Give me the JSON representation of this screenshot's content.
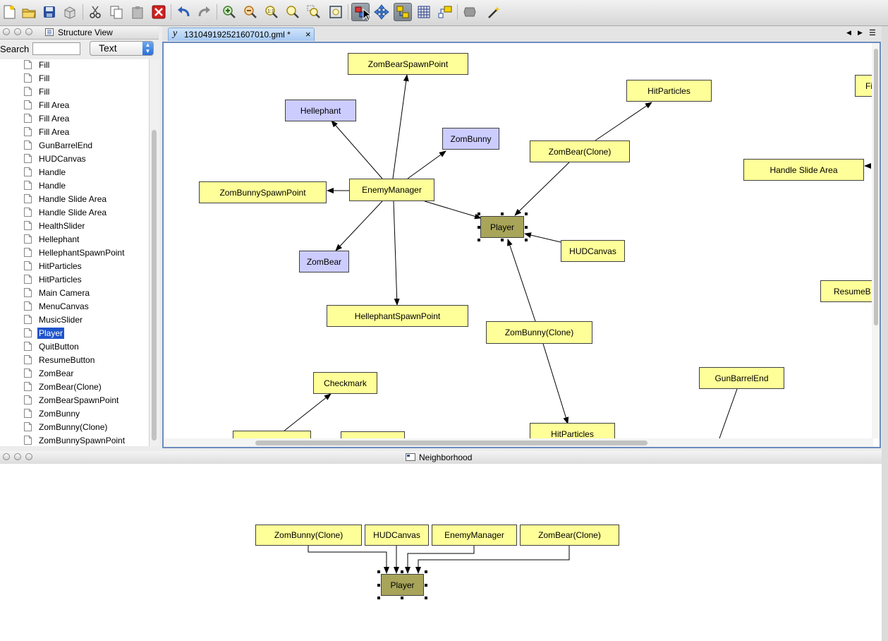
{
  "toolbar": {
    "icons": [
      "new-document",
      "open-folder",
      "save",
      "print",
      "cut",
      "copy",
      "paste",
      "delete",
      "undo",
      "redo",
      "zoom-in",
      "zoom-out",
      "zoom-actual",
      "zoom-fit",
      "zoom-area",
      "fit-content",
      "edit-mode",
      "navigate-mode",
      "snap-mode",
      "grid",
      "properties",
      "group",
      "magic-wand"
    ],
    "active": [
      "edit-mode",
      "snap-mode"
    ]
  },
  "structure": {
    "title": "Structure View",
    "search_label": "Search",
    "search_value": "",
    "filter_selected": "Text",
    "items": [
      {
        "label": "Fill"
      },
      {
        "label": "Fill"
      },
      {
        "label": "Fill"
      },
      {
        "label": "Fill Area"
      },
      {
        "label": "Fill Area"
      },
      {
        "label": "Fill Area"
      },
      {
        "label": "GunBarrelEnd"
      },
      {
        "label": "HUDCanvas"
      },
      {
        "label": "Handle"
      },
      {
        "label": "Handle"
      },
      {
        "label": "Handle Slide Area"
      },
      {
        "label": "Handle Slide Area"
      },
      {
        "label": "HealthSlider"
      },
      {
        "label": "Hellephant"
      },
      {
        "label": "HellephantSpawnPoint"
      },
      {
        "label": "HitParticles"
      },
      {
        "label": "HitParticles"
      },
      {
        "label": "Main Camera"
      },
      {
        "label": "MenuCanvas"
      },
      {
        "label": "MusicSlider"
      },
      {
        "label": "Player"
      },
      {
        "label": "QuitButton"
      },
      {
        "label": "ResumeButton"
      },
      {
        "label": "ZomBear"
      },
      {
        "label": "ZomBear(Clone)"
      },
      {
        "label": "ZomBearSpawnPoint"
      },
      {
        "label": "ZomBunny"
      },
      {
        "label": "ZomBunny(Clone)"
      },
      {
        "label": "ZomBunnySpawnPoint"
      }
    ],
    "selected": "Player"
  },
  "editor": {
    "tab_title": "131049192521607010.gml *",
    "nodes": {
      "zombear_spawn": "ZomBearSpawnPoint",
      "hellephant": "Hellephant",
      "zombunny": "ZomBunny",
      "hitparticles1": "HitParticles",
      "fi_partial": "Fi",
      "zombear_clone": "ZomBear(Clone)",
      "handle_slide": "Handle Slide Area",
      "zombunny_spawn": "ZomBunnySpawnPoint",
      "enemy_manager": "EnemyManager",
      "player": "Player",
      "hudcanvas": "HUDCanvas",
      "zombear": "ZomBear",
      "resume_partial": "ResumeB",
      "hellephant_spawn": "HellephantSpawnPoint",
      "zombunny_clone": "ZomBunny(Clone)",
      "checkmark": "Checkmark",
      "gunbarrel": "GunBarrelEnd",
      "hitparticles2": "HitParticles"
    }
  },
  "neighborhood": {
    "title": "Neighborhood",
    "nodes": [
      "ZomBunny(Clone)",
      "HUDCanvas",
      "EnemyManager",
      "ZomBear(Clone)"
    ],
    "center": "Player"
  },
  "colors": {
    "node_yellow": "#ffff99",
    "node_blue": "#ccccff",
    "node_selected": "#a8a55a",
    "selection_highlight": "#1e54cc"
  }
}
